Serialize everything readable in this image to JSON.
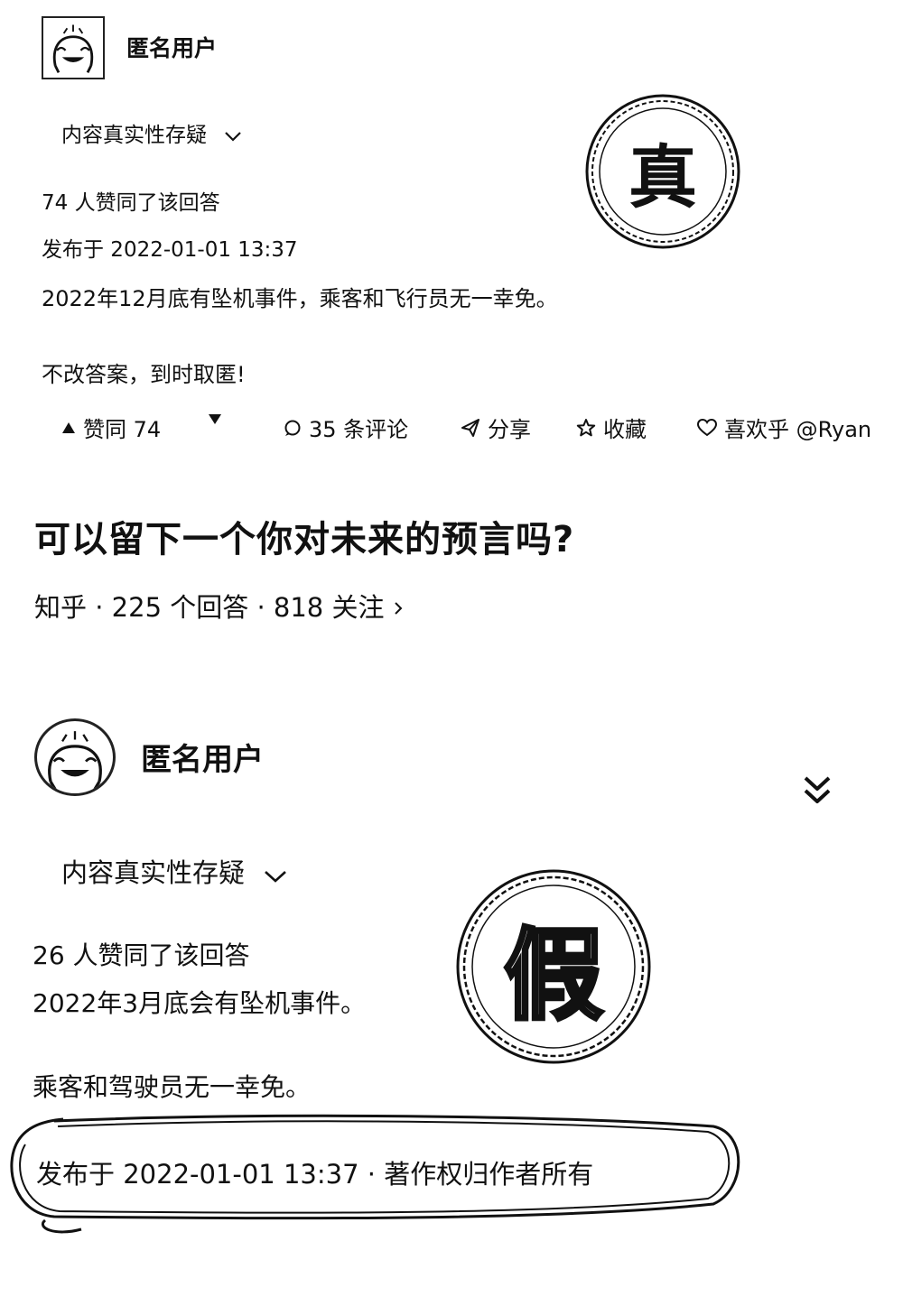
{
  "answer1": {
    "author": "匿名用户",
    "credibility_label": "内容真实性存疑",
    "likes_text": "74 人赞同了该回答",
    "published": "发布于 2022-01-01 13:37",
    "body_lines": [
      "2022年12月底有坠机事件，乘客和飞行员无一幸免。",
      "不改答案，到时取匿!"
    ],
    "stamp_char": "真",
    "actions": {
      "upvote": "赞同 74",
      "comments": "35 条评论",
      "share": "分享",
      "favorite": "收藏",
      "like_watermark": "喜欢乎 @Ryan"
    }
  },
  "question": {
    "title": "可以留下一个你对未来的预言吗?",
    "source": "知乎",
    "answer_count": "225 个回答",
    "follower_count": "818 关注",
    "separator": "·"
  },
  "answer2": {
    "author": "匿名用户",
    "credibility_label": "内容真实性存疑",
    "likes_text": "26 人赞同了该回答",
    "body_lines": [
      "2022年3月底会有坠机事件。",
      "乘客和驾驶员无一幸免。"
    ],
    "published": "发布于 2022-01-01 13:37 · 著作权归作者所有",
    "stamp_char": "假"
  },
  "icons": {
    "avatar": "laughing-face-icon",
    "chevron": "chevron-down-icon",
    "expand": "double-chevron-down-icon",
    "upvote": "triangle-up-icon",
    "downvote": "triangle-down-icon",
    "comment": "comment-bubble-icon",
    "share": "paper-plane-icon",
    "favorite": "star-icon",
    "like": "heart-icon"
  }
}
